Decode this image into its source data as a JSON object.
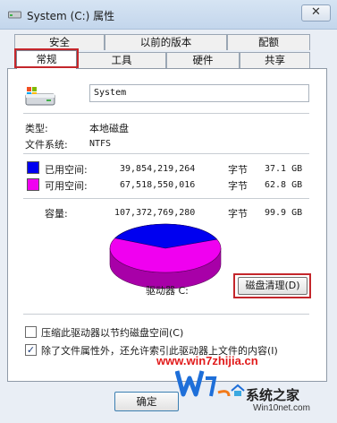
{
  "window": {
    "title": "System (C:) 属性",
    "close_glyph": "✕"
  },
  "tabs": {
    "top_row": [
      "安全",
      "以前的版本",
      "配额"
    ],
    "bottom_row": [
      "常规",
      "工具",
      "硬件",
      "共享"
    ],
    "active": "常规"
  },
  "drive": {
    "icon": "hard-drive-icon",
    "name": "System",
    "type_label": "类型:",
    "type_value": "本地磁盘",
    "fs_label": "文件系统:",
    "fs_value": "NTFS"
  },
  "space": {
    "used": {
      "label": "已用空间:",
      "bytes": "39,854,219,264",
      "unit": "字节",
      "size": "37.1 GB",
      "color": "#0000f0"
    },
    "free": {
      "label": "可用空间:",
      "bytes": "67,518,550,016",
      "unit": "字节",
      "size": "62.8 GB",
      "color": "#f000f0"
    },
    "capacity": {
      "label": "容量:",
      "bytes": "107,372,769,280",
      "unit": "字节",
      "size": "99.9 GB"
    },
    "used_fraction": 0.371
  },
  "drive_label": "驱动器 C:",
  "cleanup_button": "磁盘清理(D)",
  "options": {
    "compress": {
      "label": "压缩此驱动器以节约磁盘空间(C)",
      "checked": false
    },
    "index": {
      "label": "除了文件属性外，还允许索引此驱动器上文件的内容(I)",
      "checked": true
    }
  },
  "ok_button": "确定",
  "watermark": {
    "url": "www.win7zhijia.cn",
    "brand_cn": "系统之家",
    "brand_en": "Win10net.com"
  },
  "colors": {
    "used": "#0000f0",
    "free": "#f000f0",
    "highlight": "#c4262b"
  }
}
